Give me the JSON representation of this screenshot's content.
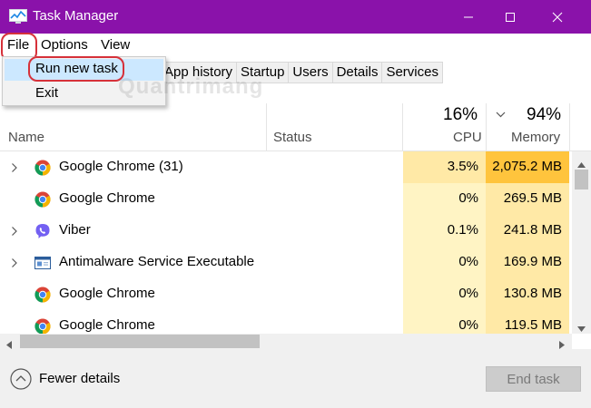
{
  "window": {
    "title": "Task Manager",
    "title_bar_color": "#8a12aa"
  },
  "menu": {
    "file": "File",
    "options": "Options",
    "view": "View",
    "file_dropdown": {
      "run_new_task": "Run new task",
      "exit": "Exit"
    }
  },
  "tabs": [
    "App history",
    "Startup",
    "Users",
    "Details",
    "Services"
  ],
  "watermark": "Quantrimang",
  "columns": {
    "name": "Name",
    "status": "Status",
    "cpu": {
      "label": "CPU",
      "percent": "16%"
    },
    "memory": {
      "label": "Memory",
      "percent": "94%"
    }
  },
  "processes": [
    {
      "name": "Google Chrome (31)",
      "icon": "chrome-icon",
      "expandable": true,
      "status": "",
      "cpu": "3.5%",
      "memory": "2,075.2 MB"
    },
    {
      "name": "Google Chrome",
      "icon": "chrome-icon",
      "expandable": false,
      "status": "",
      "cpu": "0%",
      "memory": "269.5 MB"
    },
    {
      "name": "Viber",
      "icon": "viber-icon",
      "expandable": true,
      "status": "",
      "cpu": "0.1%",
      "memory": "241.8 MB"
    },
    {
      "name": "Antimalware Service Executable",
      "icon": "service-window-icon",
      "expandable": true,
      "status": "",
      "cpu": "0%",
      "memory": "169.9 MB"
    },
    {
      "name": "Google Chrome",
      "icon": "chrome-icon",
      "expandable": false,
      "status": "",
      "cpu": "0%",
      "memory": "130.8 MB"
    },
    {
      "name": "Google Chrome",
      "icon": "chrome-icon",
      "expandable": false,
      "status": "",
      "cpu": "0%",
      "memory": "119.5 MB"
    }
  ],
  "footer": {
    "fewer_details": "Fewer details",
    "end_task": "End task"
  },
  "colors": {
    "cpu_heat_low": "#fff4c4",
    "cpu_heat_mid": "#ffe9a6",
    "memory_heat_high": "#ffc43d",
    "memory_heat_mid": "#ffe9a6",
    "selection": "#cce8ff",
    "highlight_ring": "#d6313a"
  }
}
